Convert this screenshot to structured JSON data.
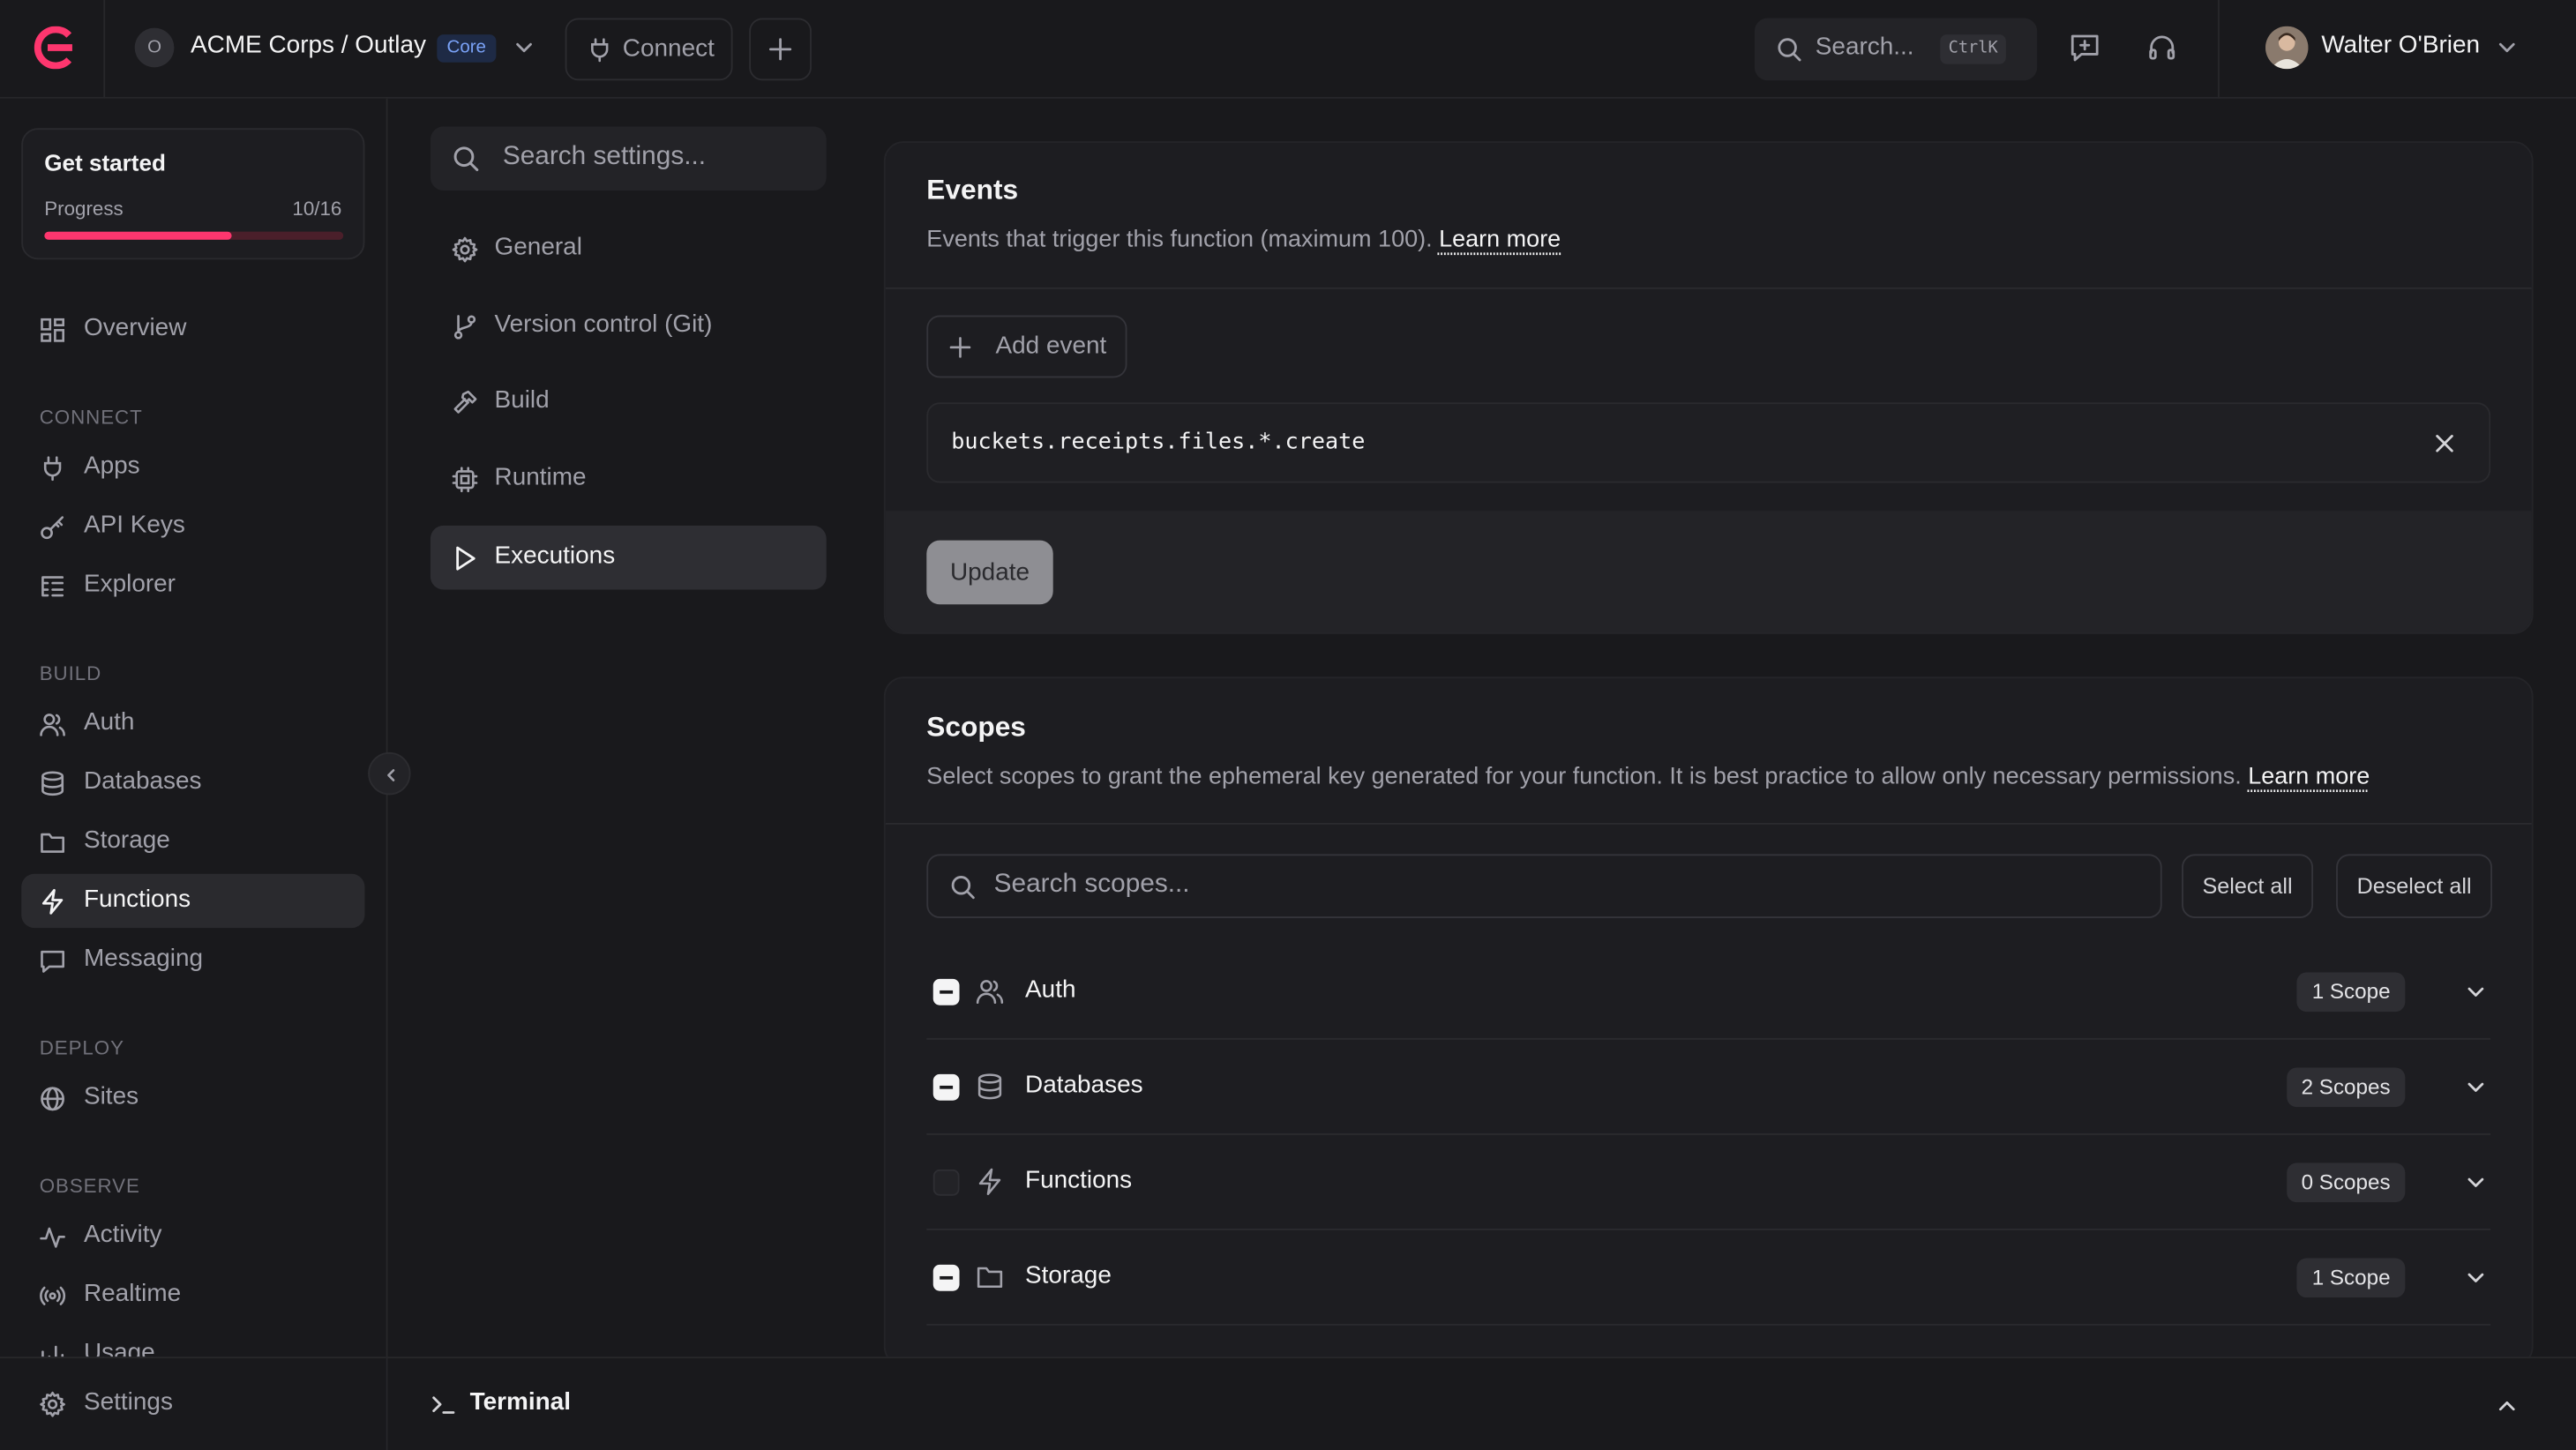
{
  "header": {
    "org_initial": "O",
    "org_title": "ACME Corps / Outlay",
    "plan_badge": "Core",
    "connect_label": "Connect",
    "search_label": "Search...",
    "search_shortcut": "CtrlK",
    "user_name": "Walter O'Brien"
  },
  "get_started": {
    "title": "Get started",
    "progress_label": "Progress",
    "progress_text": "10/16",
    "progress_fraction": 0.625
  },
  "sidebar": {
    "overview": "Overview",
    "groups": {
      "connect": "CONNECT",
      "build": "BUILD",
      "deploy": "DEPLOY",
      "observe": "OBSERVE"
    },
    "items": {
      "apps": "Apps",
      "api_keys": "API Keys",
      "explorer": "Explorer",
      "auth": "Auth",
      "databases": "Databases",
      "storage": "Storage",
      "functions": "Functions",
      "messaging": "Messaging",
      "sites": "Sites",
      "activity": "Activity",
      "realtime": "Realtime",
      "usage": "Usage",
      "settings": "Settings"
    }
  },
  "settings_menu": {
    "search_placeholder": "Search settings...",
    "items": [
      "General",
      "Version control (Git)",
      "Build",
      "Runtime",
      "Executions"
    ],
    "active": "Executions"
  },
  "events": {
    "title": "Events",
    "description": "Events that trigger this function (maximum 100).",
    "learn_more": "Learn more",
    "add_event": "Add event",
    "event_value": "buckets.receipts.files.*.create",
    "update": "Update"
  },
  "scopes": {
    "title": "Scopes",
    "description": "Select scopes to grant the ephemeral key generated for your function. It is best practice to allow only necessary permissions.",
    "learn_more": "Learn more",
    "search_placeholder": "Search scopes...",
    "select_all": "Select all",
    "deselect_all": "Deselect all",
    "rows": [
      {
        "name": "Auth",
        "badge": "1 Scope",
        "icon": "users-icon",
        "state": "partial"
      },
      {
        "name": "Databases",
        "badge": "2 Scopes",
        "icon": "database-icon",
        "state": "partial"
      },
      {
        "name": "Functions",
        "badge": "0 Scopes",
        "icon": "bolt-icon",
        "state": "none"
      },
      {
        "name": "Storage",
        "badge": "1 Scope",
        "icon": "folder-icon",
        "state": "partial"
      }
    ]
  },
  "terminal": {
    "label": "Terminal"
  },
  "colors": {
    "accent": "#fd366e",
    "background": "#19191c",
    "card": "#1d1d21"
  }
}
